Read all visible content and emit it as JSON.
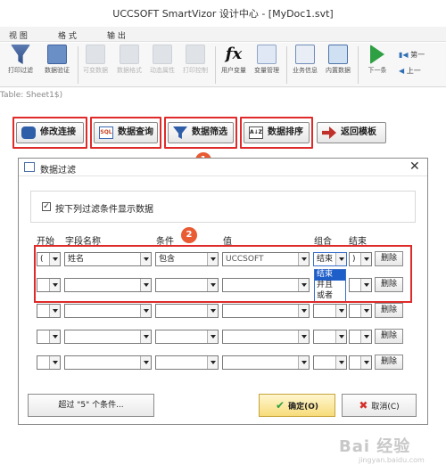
{
  "window": {
    "title": "UCCSOFT SmartVizor 设计中心 - [MyDoc1.svt]"
  },
  "menu": {
    "items": [
      "视 图",
      "格 式",
      "输 出"
    ]
  },
  "ribbon": {
    "buttons": [
      {
        "label": "打印过滤",
        "icon": "filter-icon"
      },
      {
        "label": "数据验证",
        "icon": "data-verify-icon"
      },
      {
        "label": "可变数据",
        "icon": "variable-data-icon"
      },
      {
        "label": "数据格式",
        "icon": "data-format-icon"
      },
      {
        "label": "动态属性",
        "icon": "dynamic-attr-icon"
      },
      {
        "label": "打印控制",
        "icon": "print-control-icon"
      },
      {
        "label": "用户变量",
        "icon": "fx-icon"
      },
      {
        "label": "变量管理",
        "icon": "variable-manager-icon"
      },
      {
        "label": "业务信息",
        "icon": "business-info-icon"
      },
      {
        "label": "内置数据",
        "icon": "builtin-data-icon"
      },
      {
        "label": "下一条",
        "icon": "next-icon"
      }
    ],
    "side_nav": [
      "第一",
      "上一"
    ]
  },
  "sheet_label": "Table: Sheet1$)",
  "toolbar": {
    "modify_connection": "修改连接",
    "data_query": "数据查询",
    "data_filter": "数据筛选",
    "data_sort": "数据排序",
    "return_template": "返回模板"
  },
  "badges": {
    "first": "1",
    "second": "2"
  },
  "dialog": {
    "title": "数据过滤",
    "checkbox_label": "按下列过滤条件显示数据",
    "checkbox_checked": true,
    "columns": {
      "start": "开始",
      "field": "字段名称",
      "condition": "条件",
      "value": "值",
      "combine": "组合",
      "end": "结束"
    },
    "row1": {
      "start": "(",
      "field": "姓名",
      "condition": "包含",
      "value": "UCCSOFT",
      "combine": "结束",
      "end": ")"
    },
    "combine_options": [
      "结束",
      "并且",
      "或者"
    ],
    "delete_label": "删除",
    "more_conditions": "超过 \"5\" 个条件...",
    "ok": "确定(O)",
    "cancel": "取消(C)"
  },
  "watermark": {
    "text": "Bai 经验",
    "sub": "jingyan.baidu.com"
  }
}
